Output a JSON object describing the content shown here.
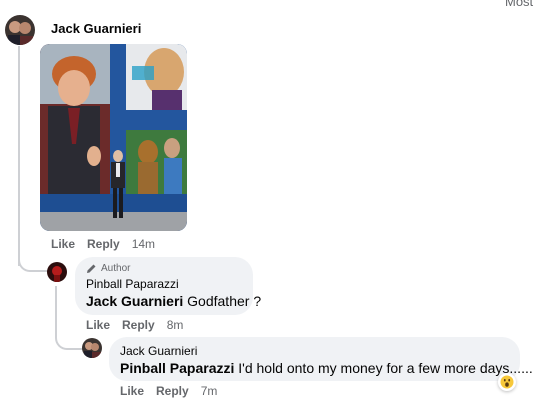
{
  "header": {
    "partial_label": "Most"
  },
  "comments": [
    {
      "author": "Jack Guarnieri",
      "actions": {
        "like": "Like",
        "reply": "Reply",
        "time": "14m"
      }
    },
    {
      "badge": "Author",
      "author": "Pinball Paparazzi",
      "mention": "Jack Guarnieri",
      "text": "Godfather ?",
      "actions": {
        "like": "Like",
        "reply": "Reply",
        "time": "8m"
      }
    },
    {
      "author": "Jack Guarnieri",
      "mention": "Pinball Paparazzi",
      "text": "I'd hold onto my money for a few more days......",
      "reaction": "wow-emoji",
      "actions": {
        "like": "Like",
        "reply": "Reply",
        "time": "7m"
      }
    }
  ],
  "icons": {
    "author_badge": "pencil-icon",
    "reaction": "wow-emoji-icon"
  },
  "colors": {
    "bubble": "#f0f2f5",
    "muted_text": "#65676b",
    "thread_line": "#ced0d4"
  }
}
